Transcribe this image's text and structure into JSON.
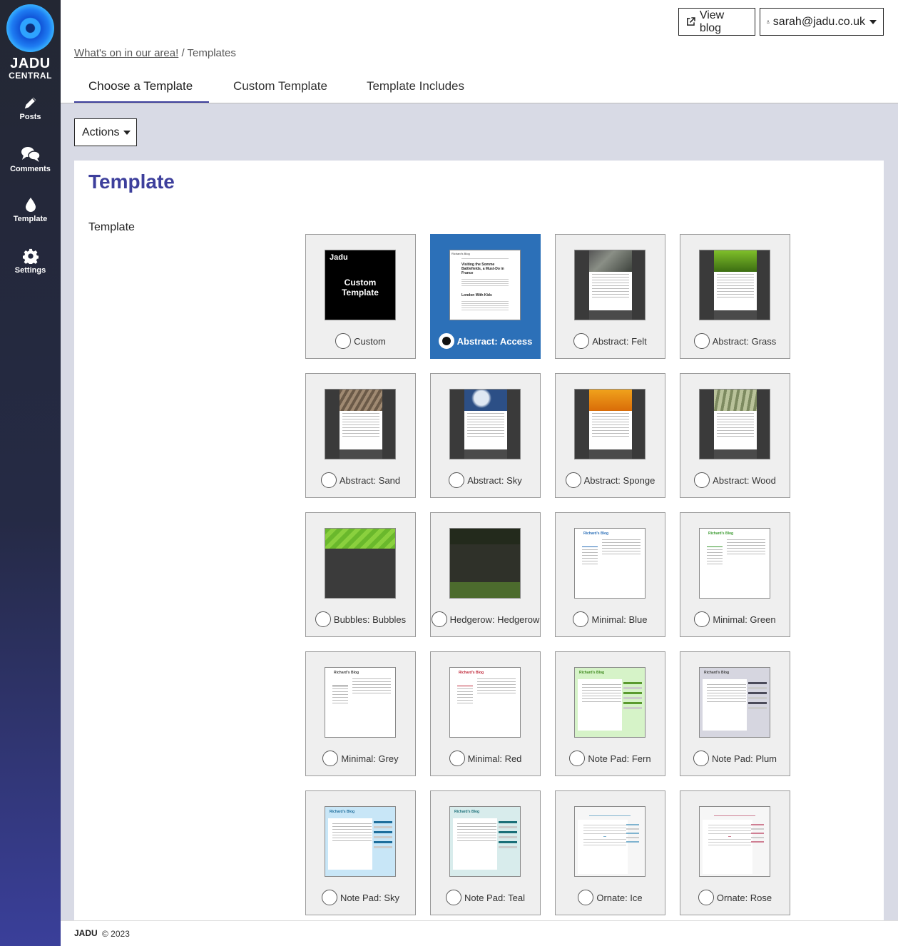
{
  "sidebar": {
    "logo_line1": "JADU",
    "logo_line2": "CENTRAL",
    "items": [
      {
        "label": "Posts",
        "icon": "pencil-icon"
      },
      {
        "label": "Comments",
        "icon": "comments-icon"
      },
      {
        "label": "Template",
        "icon": "droplet-icon"
      },
      {
        "label": "Settings",
        "icon": "gear-icon"
      }
    ]
  },
  "header": {
    "view_blog": "View blog",
    "user_email": "sarah@jadu.co.uk"
  },
  "breadcrumb": {
    "parent": "What's on in our area!",
    "separator": " / ",
    "current": "Templates"
  },
  "tabs": [
    "Choose a Template",
    "Custom Template",
    "Template Includes"
  ],
  "toolbar": {
    "actions_label": "Actions"
  },
  "panel": {
    "title": "Template",
    "field_label": "Template"
  },
  "templates": [
    {
      "label": "Custom",
      "selected": false
    },
    {
      "label": "Abstract: Access",
      "selected": true
    },
    {
      "label": "Abstract: Felt",
      "selected": false
    },
    {
      "label": "Abstract: Grass",
      "selected": false
    },
    {
      "label": "Abstract: Sand",
      "selected": false
    },
    {
      "label": "Abstract: Sky",
      "selected": false
    },
    {
      "label": "Abstract: Sponge",
      "selected": false
    },
    {
      "label": "Abstract: Wood",
      "selected": false
    },
    {
      "label": "Bubbles: Bubbles",
      "selected": false
    },
    {
      "label": "Hedgerow: Hedgerow",
      "selected": false
    },
    {
      "label": "Minimal: Blue",
      "selected": false
    },
    {
      "label": "Minimal: Green",
      "selected": false
    },
    {
      "label": "Minimal: Grey",
      "selected": false
    },
    {
      "label": "Minimal: Red",
      "selected": false
    },
    {
      "label": "Note Pad: Fern",
      "selected": false
    },
    {
      "label": "Note Pad: Plum",
      "selected": false
    },
    {
      "label": "Note Pad: Sky",
      "selected": false
    },
    {
      "label": "Note Pad: Teal",
      "selected": false
    },
    {
      "label": "Ornate: Ice",
      "selected": false
    },
    {
      "label": "Ornate: Rose",
      "selected": false
    }
  ],
  "thumbs": {
    "custom_brand": "Jadu",
    "custom_line1": "Custom",
    "custom_line2": "Template",
    "access_blog": "Richard's Blog",
    "access_heading1": "Visiting the Somme Battlefields, a Must-Do in France",
    "access_heading2": "London With Kids",
    "blog_name": "Richard's Blog"
  },
  "colors": {
    "brand": "#3d3f9c",
    "selected": "#2c70b8"
  },
  "footer": {
    "brand": "JADU",
    "copyright": "© 2023"
  }
}
